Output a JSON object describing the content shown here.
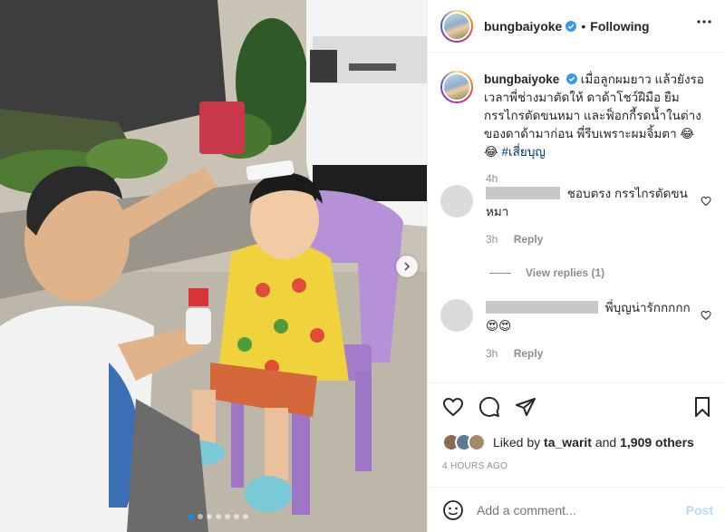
{
  "post": {
    "username": "bungbaiyoke",
    "follow_status": "Following",
    "more_icon": "more-horizontal-icon",
    "photo_alt": "Father cutting son's hair outdoors"
  },
  "caption": {
    "username": "bungbaiyoke",
    "text": "เมื่อลูกผมยาว แล้วยังรอเวลาพี่ช่างมาตัดให้ ดาด้าโชว์ฝีมือ ยืมกรรไกรตัดขนหมา และฟ็อกกี้รดน้ำในต่างของดาด้ามาก่อน พี่รีบเพราะผมจิ้มตา 😂 😂",
    "hashtag": "#เสี่ยบุญ",
    "time": "4h"
  },
  "comments": [
    {
      "text": "ชอบตรง กรรไกรตัดขนหมา",
      "time": "3h",
      "reply_label": "Reply"
    },
    {
      "text": "พี่บุญน่ารักกกกก 😍😍",
      "time": "3h",
      "reply_label": "Reply"
    }
  ],
  "view_replies": "View replies (1)",
  "likes": {
    "prefix": "Liked by",
    "user": "ta_warit",
    "joiner": "and",
    "count": "1,909 others"
  },
  "posted_ago": "4 HOURS AGO",
  "add_comment": {
    "placeholder": "Add a comment...",
    "post_label": "Post"
  },
  "carousel": {
    "total": 7,
    "active": 0
  },
  "colors": {
    "accent": "#0095f6",
    "link": "#00376b",
    "muted": "#8e8e8e",
    "post_disabled": "#b3dbff"
  }
}
